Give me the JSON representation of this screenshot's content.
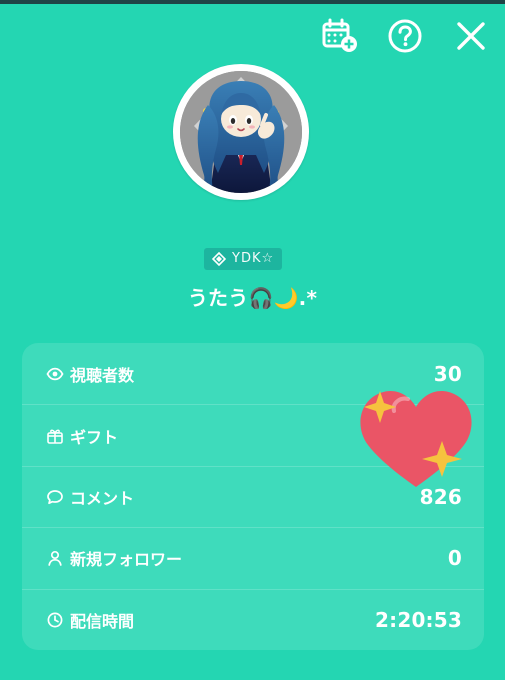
{
  "top_bar": {
    "icons": [
      "calendar-add-icon",
      "help-icon",
      "close-icon"
    ]
  },
  "profile": {
    "badge": "YDK☆",
    "username": "うたう🎧🌙.*"
  },
  "stats": [
    {
      "icon": "eye-icon",
      "label": "視聴者数",
      "value": "30"
    },
    {
      "icon": "gift-icon",
      "label": "ギフト",
      "value": ""
    },
    {
      "icon": "comment-icon",
      "label": "コメント",
      "value": "826"
    },
    {
      "icon": "person-icon",
      "label": "新規フォロワー",
      "value": "0"
    },
    {
      "icon": "clock-icon",
      "label": "配信時間",
      "value": "2:20:53"
    }
  ],
  "colors": {
    "background": "#24d6b2",
    "heart": "#ea5566",
    "sparkle": "#f6c33e"
  }
}
